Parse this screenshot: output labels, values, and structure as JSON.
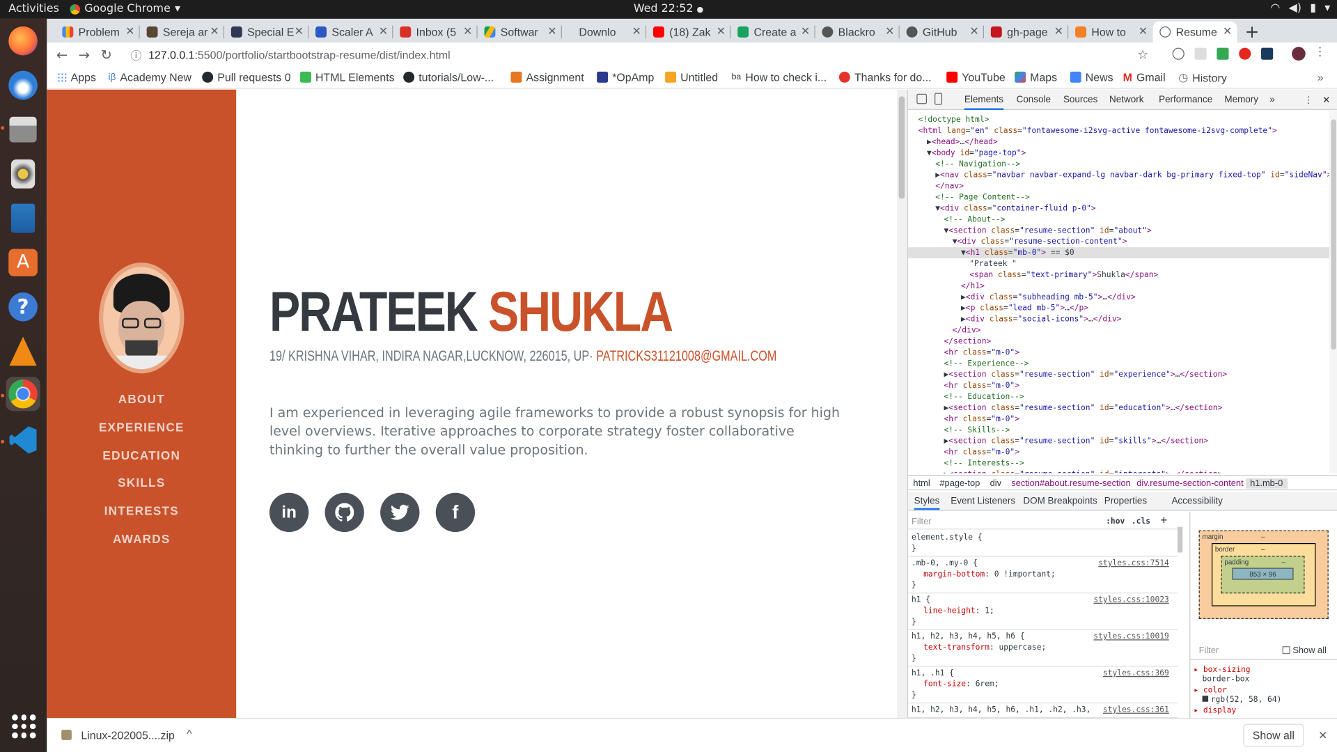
{
  "topbar": {
    "activities": "Activities",
    "app_name": "Google Chrome",
    "clock": "Wed 22:52"
  },
  "tabs": [
    "Problem",
    "Sereja ar",
    "Special E",
    "Scaler A",
    "Inbox (5",
    "Softwar",
    "Downlo",
    "(18) Zak",
    "Create a",
    "Blackro",
    "GitHub",
    "gh-page",
    "How to",
    "Resume"
  ],
  "address": {
    "host": "127.0.0.1",
    "path": ":5500/portfolio/startbootstrap-resume/dist/index.html"
  },
  "bookmarks": [
    "Apps",
    "Academy New",
    "Pull requests 0",
    "HTML Elements",
    "tutorials/Low-...",
    "Assignment",
    "*OpAmp",
    "Untitled",
    "How to check i...",
    "Thanks for do...",
    "YouTube",
    "Maps",
    "News",
    "Gmail",
    "History"
  ],
  "resume": {
    "first_name": "PRATEEK",
    "last_name": "SHUKLA",
    "address": "19/ KRISHNA VIHAR, INDIRA NAGAR,LUCKNOW, 226015, UP· ",
    "email": "PATRICKS31121008@GMAIL.COM",
    "lead": "I am experienced in leveraging agile frameworks to provide a robust synopsis for high level overviews. Iterative approaches to corporate strategy foster collaborative thinking to further the overall value proposition.",
    "nav": [
      "ABOUT",
      "EXPERIENCE",
      "EDUCATION",
      "SKILLS",
      "INTERESTS",
      "AWARDS"
    ]
  },
  "devtools": {
    "tabs": [
      "Elements",
      "Console",
      "Sources",
      "Network",
      "Performance",
      "Memory"
    ],
    "dom_lines": [
      {
        "i": 0,
        "html": "<span class='cm'>&lt;!doctype html&gt;</span>"
      },
      {
        "i": 0,
        "html": "<span class='tg'>&lt;html</span> <span class='at'>lang</span>=<span class='av'>\"en\"</span> <span class='at'>class</span>=<span class='av'>\"fontawesome-i2svg-active fontawesome-i2svg-complete\"</span><span class='tg'>&gt;</span>"
      },
      {
        "i": 1,
        "html": "▶<span class='tg'>&lt;head&gt;</span>…<span class='tg'>&lt;/head&gt;</span>"
      },
      {
        "i": 1,
        "html": "▼<span class='tg'>&lt;body</span> <span class='at'>id</span>=<span class='av'>\"page-top\"</span><span class='tg'>&gt;</span>"
      },
      {
        "i": 2,
        "html": "<span class='cm'>&lt;!-- Navigation--&gt;</span>"
      },
      {
        "i": 2,
        "html": "▶<span class='tg'>&lt;nav</span> <span class='at'>class</span>=<span class='av'>\"navbar navbar-expand-lg navbar-dark bg-primary fixed-top\"</span> <span class='at'>id</span>=<span class='av'>\"sideNav\"</span><span class='tg'>&gt;</span>…"
      },
      {
        "i": 2,
        "html": "<span class='tg'>&lt;/nav&gt;</span>"
      },
      {
        "i": 2,
        "html": "<span class='cm'>&lt;!-- Page Content--&gt;</span>"
      },
      {
        "i": 2,
        "html": "▼<span class='tg'>&lt;div</span> <span class='at'>class</span>=<span class='av'>\"container-fluid p-0\"</span><span class='tg'>&gt;</span>"
      },
      {
        "i": 3,
        "html": "<span class='cm'>&lt;!-- About--&gt;</span>"
      },
      {
        "i": 3,
        "html": "▼<span class='tg'>&lt;section</span> <span class='at'>class</span>=<span class='av'>\"resume-section\"</span> <span class='at'>id</span>=<span class='av'>\"about\"</span><span class='tg'>&gt;</span>"
      },
      {
        "i": 4,
        "html": "▼<span class='tg'>&lt;div</span> <span class='at'>class</span>=<span class='av'>\"resume-section-content\"</span><span class='tg'>&gt;</span>"
      },
      {
        "i": 5,
        "html": "▼<span class='tg'>&lt;h1</span> <span class='at'>class</span>=<span class='av'>\"mb-0\"</span><span class='tg'>&gt;</span> == $0",
        "sel": true
      },
      {
        "i": 6,
        "html": "<span class='tx'>\"Prateek \"</span>"
      },
      {
        "i": 6,
        "html": "<span class='tg'>&lt;span</span> <span class='at'>class</span>=<span class='av'>\"text-primary\"</span><span class='tg'>&gt;</span>Shukla<span class='tg'>&lt;/span&gt;</span>"
      },
      {
        "i": 5,
        "html": "<span class='tg'>&lt;/h1&gt;</span>"
      },
      {
        "i": 5,
        "html": "▶<span class='tg'>&lt;div</span> <span class='at'>class</span>=<span class='av'>\"subheading mb-5\"</span><span class='tg'>&gt;</span>…<span class='tg'>&lt;/div&gt;</span>"
      },
      {
        "i": 5,
        "html": "▶<span class='tg'>&lt;p</span> <span class='at'>class</span>=<span class='av'>\"lead mb-5\"</span><span class='tg'>&gt;</span>…<span class='tg'>&lt;/p&gt;</span>"
      },
      {
        "i": 5,
        "html": "▶<span class='tg'>&lt;div</span> <span class='at'>class</span>=<span class='av'>\"social-icons\"</span><span class='tg'>&gt;</span>…<span class='tg'>&lt;/div&gt;</span>"
      },
      {
        "i": 4,
        "html": "<span class='tg'>&lt;/div&gt;</span>"
      },
      {
        "i": 3,
        "html": "<span class='tg'>&lt;/section&gt;</span>"
      },
      {
        "i": 3,
        "html": "<span class='tg'>&lt;hr</span> <span class='at'>class</span>=<span class='av'>\"m-0\"</span><span class='tg'>&gt;</span>"
      },
      {
        "i": 3,
        "html": "<span class='cm'>&lt;!-- Experience--&gt;</span>"
      },
      {
        "i": 3,
        "html": "▶<span class='tg'>&lt;section</span> <span class='at'>class</span>=<span class='av'>\"resume-section\"</span> <span class='at'>id</span>=<span class='av'>\"experience\"</span><span class='tg'>&gt;</span>…<span class='tg'>&lt;/section&gt;</span>"
      },
      {
        "i": 3,
        "html": "<span class='tg'>&lt;hr</span> <span class='at'>class</span>=<span class='av'>\"m-0\"</span><span class='tg'>&gt;</span>"
      },
      {
        "i": 3,
        "html": "<span class='cm'>&lt;!-- Education--&gt;</span>"
      },
      {
        "i": 3,
        "html": "▶<span class='tg'>&lt;section</span> <span class='at'>class</span>=<span class='av'>\"resume-section\"</span> <span class='at'>id</span>=<span class='av'>\"education\"</span><span class='tg'>&gt;</span>…<span class='tg'>&lt;/section&gt;</span>"
      },
      {
        "i": 3,
        "html": "<span class='tg'>&lt;hr</span> <span class='at'>class</span>=<span class='av'>\"m-0\"</span><span class='tg'>&gt;</span>"
      },
      {
        "i": 3,
        "html": "<span class='cm'>&lt;!-- Skills--&gt;</span>"
      },
      {
        "i": 3,
        "html": "▶<span class='tg'>&lt;section</span> <span class='at'>class</span>=<span class='av'>\"resume-section\"</span> <span class='at'>id</span>=<span class='av'>\"skills\"</span><span class='tg'>&gt;</span>…<span class='tg'>&lt;/section&gt;</span>"
      },
      {
        "i": 3,
        "html": "<span class='tg'>&lt;hr</span> <span class='at'>class</span>=<span class='av'>\"m-0\"</span><span class='tg'>&gt;</span>"
      },
      {
        "i": 3,
        "html": "<span class='cm'>&lt;!-- Interests--&gt;</span>"
      },
      {
        "i": 3,
        "html": "▶<span class='tg'>&lt;section</span> <span class='at'>class</span>=<span class='av'>\"resume-section\"</span> <span class='at'>id</span>=<span class='av'>\"interests\"</span><span class='tg'>&gt;</span>…<span class='tg'>&lt;/section&gt;</span>"
      }
    ],
    "crumbs": [
      "html",
      "#page-top",
      "div",
      "section#about.resume-section",
      "div.resume-section-content",
      "h1.mb-0"
    ],
    "style_tabs": [
      "Styles",
      "Event Listeners",
      "DOM Breakpoints",
      "Properties",
      "Accessibility"
    ],
    "filter": "Filter",
    "hov": ":hov",
    "cls": ".cls",
    "rules": [
      {
        "sel": "element.style {",
        "src": "",
        "props": []
      },
      {
        "sel": ".mb-0, .my-0 {",
        "src": "styles.css:7514",
        "props": [
          "margin-bottom: 0 !important;"
        ]
      },
      {
        "sel": "h1 {",
        "src": "styles.css:10023",
        "props": [
          "line-height: 1;"
        ]
      },
      {
        "sel": "h1, h2, h3, h4, h5, h6 {",
        "src": "styles.css:10019",
        "props": [
          "text-transform: uppercase;"
        ]
      },
      {
        "sel": "h1, .h1 {",
        "src": "styles.css:369",
        "props": [
          "font-size: 6rem;"
        ]
      },
      {
        "sel": "h1, h2, h3, h4, h5, h6, .h1, .h2, .h3,",
        "src": "styles.css:361",
        "props": []
      }
    ],
    "box": {
      "margin": "margin",
      "border": "border",
      "padding": "padding",
      "size": "853 × 96",
      "dash": "–"
    },
    "computed": {
      "filter": "Filter",
      "show_all": "Show all",
      "p1": "box-sizing",
      "v1": "border-box",
      "p2": "color",
      "v2": "rgb(52, 58, 64)",
      "p3": "display"
    }
  },
  "shelf": {
    "file": "Linux-202005....zip",
    "show_all": "Show all"
  }
}
